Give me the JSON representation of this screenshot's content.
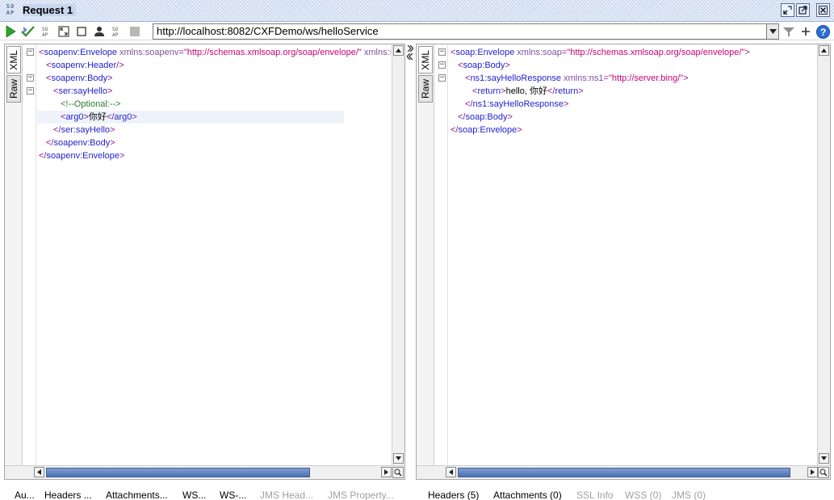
{
  "title_bar": {
    "logo_text": "SO AP",
    "title": "Request 1",
    "buttons": [
      "minimize-icon",
      "maximize-icon",
      "close-icon"
    ]
  },
  "toolbar": {
    "icons": [
      "run-icon",
      "run-all-icon",
      "soap-icon",
      "fit-icon",
      "stop-icon",
      "user-icon",
      "soap-icon-2",
      "disabled-icon"
    ],
    "url": "http://localhost:8082/CXFDemo/ws/helloService",
    "right_icons": [
      "dropdown-icon",
      "settings-icon",
      "add-icon",
      "help-icon"
    ]
  },
  "request_panel": {
    "tabs": [
      "XML",
      "Raw"
    ],
    "active_tab": "XML",
    "lines": [
      {
        "indent": 0,
        "fold": "−",
        "parts": [
          {
            "c": "t-tag",
            "t": "<"
          },
          {
            "c": "t-name",
            "t": "soapenv:Envelope"
          },
          {
            "c": "t-text",
            "t": " "
          },
          {
            "c": "t-attr",
            "t": "xmlns:soapenv"
          },
          {
            "c": "t-tag",
            "t": "="
          },
          {
            "c": "t-val",
            "t": "\"http://schemas.xmlsoap.org/soap/envelope/\""
          },
          {
            "c": "t-text",
            "t": " "
          },
          {
            "c": "t-attr",
            "t": "xmlns:ser"
          }
        ]
      },
      {
        "indent": 1,
        "fold": "",
        "parts": [
          {
            "c": "t-tag",
            "t": "<"
          },
          {
            "c": "t-name",
            "t": "soapenv:Header"
          },
          {
            "c": "t-tag",
            "t": "/>"
          }
        ]
      },
      {
        "indent": 1,
        "fold": "−",
        "parts": [
          {
            "c": "t-tag",
            "t": "<"
          },
          {
            "c": "t-name",
            "t": "soapenv:Body"
          },
          {
            "c": "t-tag",
            "t": ">"
          }
        ]
      },
      {
        "indent": 2,
        "fold": "−",
        "parts": [
          {
            "c": "t-tag",
            "t": "<"
          },
          {
            "c": "t-name",
            "t": "ser:sayHello"
          },
          {
            "c": "t-tag",
            "t": ">"
          }
        ]
      },
      {
        "indent": 3,
        "fold": "",
        "parts": [
          {
            "c": "t-comment",
            "t": "<!--Optional:-->"
          }
        ]
      },
      {
        "indent": 3,
        "fold": "",
        "highlight": true,
        "parts": [
          {
            "c": "t-tag",
            "t": "<"
          },
          {
            "c": "t-name",
            "t": "arg0"
          },
          {
            "c": "t-tag",
            "t": ">"
          },
          {
            "c": "t-text",
            "t": "你好"
          },
          {
            "c": "t-tag",
            "t": "</"
          },
          {
            "c": "t-name",
            "t": "arg0"
          },
          {
            "c": "t-tag",
            "t": ">"
          }
        ]
      },
      {
        "indent": 2,
        "fold": "",
        "parts": [
          {
            "c": "t-tag",
            "t": "</"
          },
          {
            "c": "t-name",
            "t": "ser:sayHello"
          },
          {
            "c": "t-tag",
            "t": ">"
          }
        ]
      },
      {
        "indent": 1,
        "fold": "",
        "parts": [
          {
            "c": "t-tag",
            "t": "</"
          },
          {
            "c": "t-name",
            "t": "soapenv:Body"
          },
          {
            "c": "t-tag",
            "t": ">"
          }
        ]
      },
      {
        "indent": 0,
        "fold": "",
        "parts": [
          {
            "c": "t-tag",
            "t": "</"
          },
          {
            "c": "t-name",
            "t": "soapenv:Envelope"
          },
          {
            "c": "t-tag",
            "t": ">"
          }
        ]
      }
    ]
  },
  "response_panel": {
    "tabs": [
      "XML",
      "Raw"
    ],
    "active_tab": "XML",
    "lines": [
      {
        "indent": 0,
        "fold": "−",
        "parts": [
          {
            "c": "t-tag",
            "t": "<"
          },
          {
            "c": "t-name",
            "t": "soap:Envelope"
          },
          {
            "c": "t-text",
            "t": " "
          },
          {
            "c": "t-attr",
            "t": "xmlns:soap"
          },
          {
            "c": "t-tag",
            "t": "="
          },
          {
            "c": "t-val",
            "t": "\"http://schemas.xmlsoap.org/soap/envelope/\""
          },
          {
            "c": "t-tag",
            "t": ">"
          }
        ]
      },
      {
        "indent": 1,
        "fold": "−",
        "parts": [
          {
            "c": "t-tag",
            "t": "<"
          },
          {
            "c": "t-name",
            "t": "soap:Body"
          },
          {
            "c": "t-tag",
            "t": ">"
          }
        ]
      },
      {
        "indent": 2,
        "fold": "−",
        "parts": [
          {
            "c": "t-tag",
            "t": "<"
          },
          {
            "c": "t-name",
            "t": "ns1:sayHelloResponse"
          },
          {
            "c": "t-text",
            "t": " "
          },
          {
            "c": "t-attr",
            "t": "xmlns:ns1"
          },
          {
            "c": "t-tag",
            "t": "="
          },
          {
            "c": "t-val",
            "t": "\"http://server.bing/\""
          },
          {
            "c": "t-tag",
            "t": ">"
          }
        ]
      },
      {
        "indent": 3,
        "fold": "",
        "parts": [
          {
            "c": "t-tag",
            "t": "<"
          },
          {
            "c": "t-name",
            "t": "return"
          },
          {
            "c": "t-tag",
            "t": ">"
          },
          {
            "c": "t-text",
            "t": "hello, 你好"
          },
          {
            "c": "t-tag",
            "t": "</"
          },
          {
            "c": "t-name",
            "t": "return"
          },
          {
            "c": "t-tag",
            "t": ">"
          }
        ]
      },
      {
        "indent": 2,
        "fold": "",
        "parts": [
          {
            "c": "t-tag",
            "t": "</"
          },
          {
            "c": "t-name",
            "t": "ns1:sayHelloResponse"
          },
          {
            "c": "t-tag",
            "t": ">"
          }
        ]
      },
      {
        "indent": 1,
        "fold": "",
        "parts": [
          {
            "c": "t-tag",
            "t": "</"
          },
          {
            "c": "t-name",
            "t": "soap:Body"
          },
          {
            "c": "t-tag",
            "t": ">"
          }
        ]
      },
      {
        "indent": 0,
        "fold": "",
        "parts": [
          {
            "c": "t-tag",
            "t": "</"
          },
          {
            "c": "t-name",
            "t": "soap:Envelope"
          },
          {
            "c": "t-tag",
            "t": ">"
          }
        ]
      }
    ]
  },
  "request_bottom_tabs": [
    {
      "label": "Au...",
      "enabled": true
    },
    {
      "label": "Headers ...",
      "enabled": true
    },
    {
      "label": "Attachments...",
      "enabled": true
    },
    {
      "label": "WS...",
      "enabled": true
    },
    {
      "label": "WS-...",
      "enabled": true
    },
    {
      "label": "JMS Head...",
      "enabled": false
    },
    {
      "label": "JMS Property...",
      "enabled": false
    }
  ],
  "response_bottom_tabs": [
    {
      "label": "Headers (5)",
      "enabled": true
    },
    {
      "label": "Attachments (0)",
      "enabled": true
    },
    {
      "label": "SSL Info",
      "enabled": false
    },
    {
      "label": "WSS (0)",
      "enabled": false
    },
    {
      "label": "JMS (0)",
      "enabled": false
    }
  ],
  "colors": {
    "title_bg": "#c8d7ee",
    "tag": "#8b1a8b",
    "element_name": "#2222cc",
    "attribute": "#7f4fa0",
    "value": "#cc0077",
    "comment": "#2a7a2a",
    "scroll_thumb": "#4f73b6"
  }
}
